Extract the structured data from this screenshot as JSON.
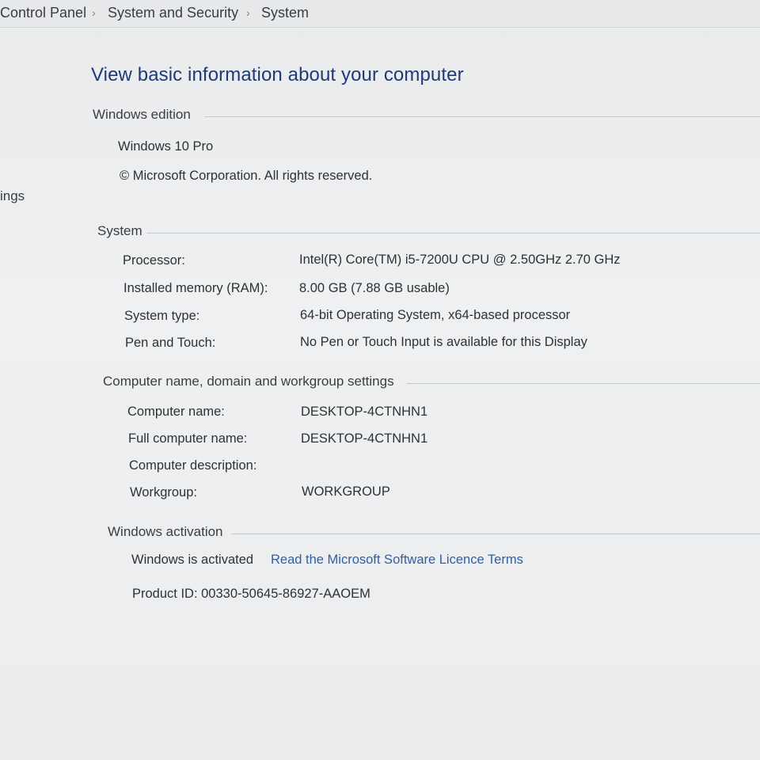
{
  "breadcrumb": {
    "items": [
      "Control Panel",
      "System and Security",
      "System"
    ],
    "separator": "›"
  },
  "sidebar": {
    "partial_link": "ings"
  },
  "page": {
    "title": "View basic information about your computer"
  },
  "windows_edition": {
    "header": "Windows edition",
    "edition": "Windows 10 Pro",
    "copyright": "© Microsoft Corporation. All rights reserved."
  },
  "system": {
    "header": "System",
    "rows": [
      {
        "label": "Processor:",
        "value": "Intel(R) Core(TM) i5-7200U CPU @ 2.50GHz   2.70 GHz"
      },
      {
        "label": "Installed memory (RAM):",
        "value": "8.00 GB (7.88 GB usable)"
      },
      {
        "label": "System type:",
        "value": "64-bit Operating System, x64-based processor"
      },
      {
        "label": "Pen and Touch:",
        "value": "No Pen or Touch Input is available for this Display"
      }
    ]
  },
  "computer_name": {
    "header": "Computer name, domain and workgroup settings",
    "rows": [
      {
        "label": "Computer name:",
        "value": "DESKTOP-4CTNHN1"
      },
      {
        "label": "Full computer name:",
        "value": "DESKTOP-4CTNHN1"
      },
      {
        "label": "Computer description:",
        "value": ""
      },
      {
        "label": "Workgroup:",
        "value": "WORKGROUP"
      }
    ]
  },
  "activation": {
    "header": "Windows activation",
    "status": "Windows is activated",
    "licence_link": "Read the Microsoft Software Licence Terms",
    "product_id": "Product ID: 00330-50645-86927-AAOEM"
  },
  "colors": {
    "title": "#1e3a78",
    "link": "#2f5fa8",
    "text": "#2e3236",
    "background": "#eceeef"
  }
}
